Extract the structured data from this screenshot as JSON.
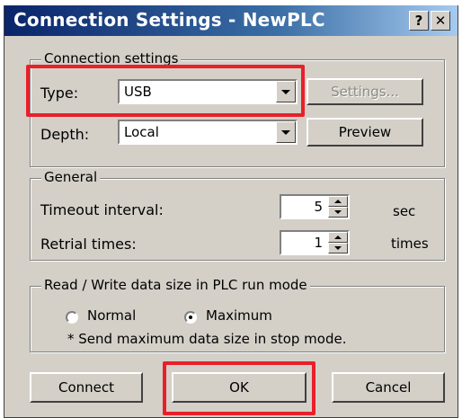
{
  "window": {
    "title": "Connection Settings - NewPLC"
  },
  "titlebar": {
    "help_glyph": "?",
    "close_glyph": "✕"
  },
  "connection_settings": {
    "group_label": "Connection settings",
    "type_label": "Type:",
    "type_value": "USB",
    "settings_button": "Settings...",
    "depth_label": "Depth:",
    "depth_value": "Local",
    "preview_button": "Preview"
  },
  "general": {
    "group_label": "General",
    "timeout_label": "Timeout interval:",
    "timeout_value": "5",
    "timeout_unit": "sec",
    "retrial_label": "Retrial times:",
    "retrial_value": "1",
    "retrial_unit": "times"
  },
  "data_size": {
    "group_label": "Read / Write data size in PLC run mode",
    "normal_label": "Normal",
    "maximum_label": "Maximum",
    "selected": "Maximum",
    "note": "* Send maximum data size in stop mode."
  },
  "footer": {
    "connect_button": "Connect",
    "ok_button": "OK",
    "cancel_button": "Cancel"
  },
  "highlight_color": "#e8202a"
}
